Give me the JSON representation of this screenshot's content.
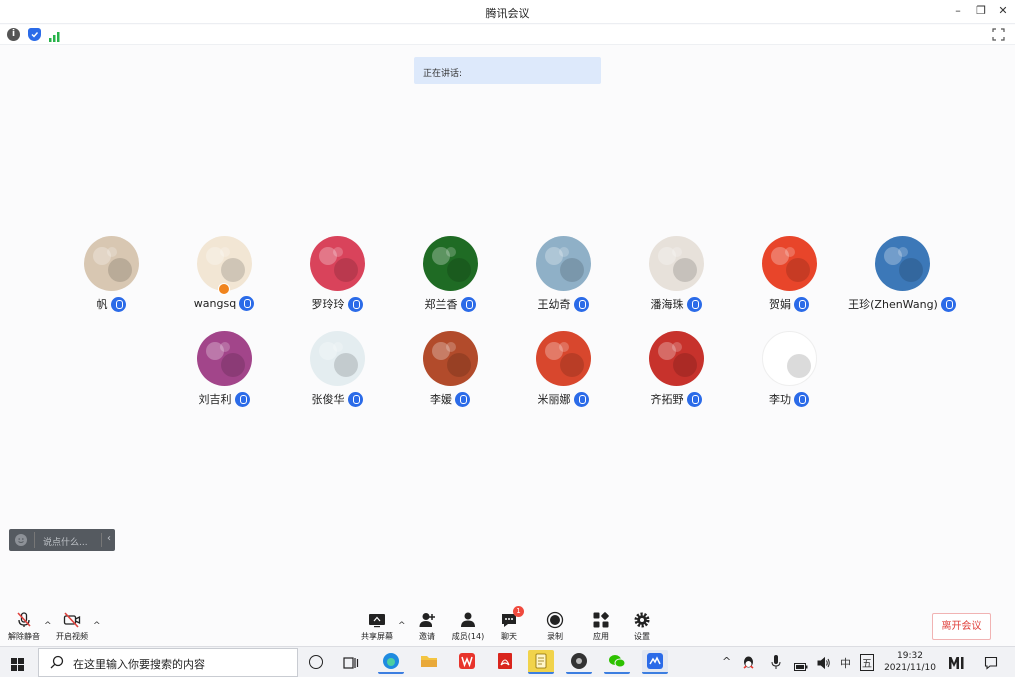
{
  "window": {
    "title": "腾讯会议",
    "min": "–",
    "restore": "❐",
    "close": "✕"
  },
  "status_icons": {
    "info": "i",
    "shield": "shield-icon",
    "signal": "signal-icon"
  },
  "speaking": {
    "label": "正在讲话:"
  },
  "participants": [
    {
      "name": "帆",
      "host": false,
      "color": "#d8c7b2",
      "row": 0
    },
    {
      "name": "wangsq",
      "host": true,
      "color": "#f2e6d4",
      "row": 0
    },
    {
      "name": "罗玲玲",
      "host": false,
      "color": "#d9435b",
      "row": 0
    },
    {
      "name": "郑兰香",
      "host": false,
      "color": "#1f6b24",
      "row": 0
    },
    {
      "name": "王幼奇",
      "host": false,
      "color": "#8fb0c7",
      "row": 0
    },
    {
      "name": "潘海珠",
      "host": false,
      "color": "#e7e1da",
      "row": 0
    },
    {
      "name": "贺娟",
      "host": false,
      "color": "#e8452a",
      "row": 0
    },
    {
      "name": "王珍(ZhenWang)",
      "host": false,
      "color": "#3c78b8",
      "row": 0
    },
    {
      "name": "刘吉利",
      "host": false,
      "color": "#a2458a",
      "row": 1
    },
    {
      "name": "张俊华",
      "host": false,
      "color": "#e4edf0",
      "row": 1
    },
    {
      "name": "李媛",
      "host": false,
      "color": "#b24b2b",
      "row": 1
    },
    {
      "name": "米丽娜",
      "host": false,
      "color": "#d8472d",
      "row": 1
    },
    {
      "name": "齐拓野",
      "host": false,
      "color": "#c7322c",
      "row": 1
    },
    {
      "name": "李功",
      "host": false,
      "color": "#ffffff",
      "row": 1
    }
  ],
  "chat": {
    "placeholder": "说点什么...",
    "collapse": "‹"
  },
  "toolbar": {
    "unmute": "解除静音",
    "start_video": "开启视频",
    "share": "共享屏幕",
    "invite": "邀请",
    "members": "成员(14)",
    "chat": "聊天",
    "chat_badge": "1",
    "record": "录制",
    "apps": "应用",
    "settings": "设置",
    "leave": "离开会议"
  },
  "taskbar": {
    "search_placeholder": "在这里输入你要搜索的内容",
    "time": "19:32",
    "date": "2021/11/10",
    "ime_lang": "中",
    "ime_mode": "五"
  }
}
